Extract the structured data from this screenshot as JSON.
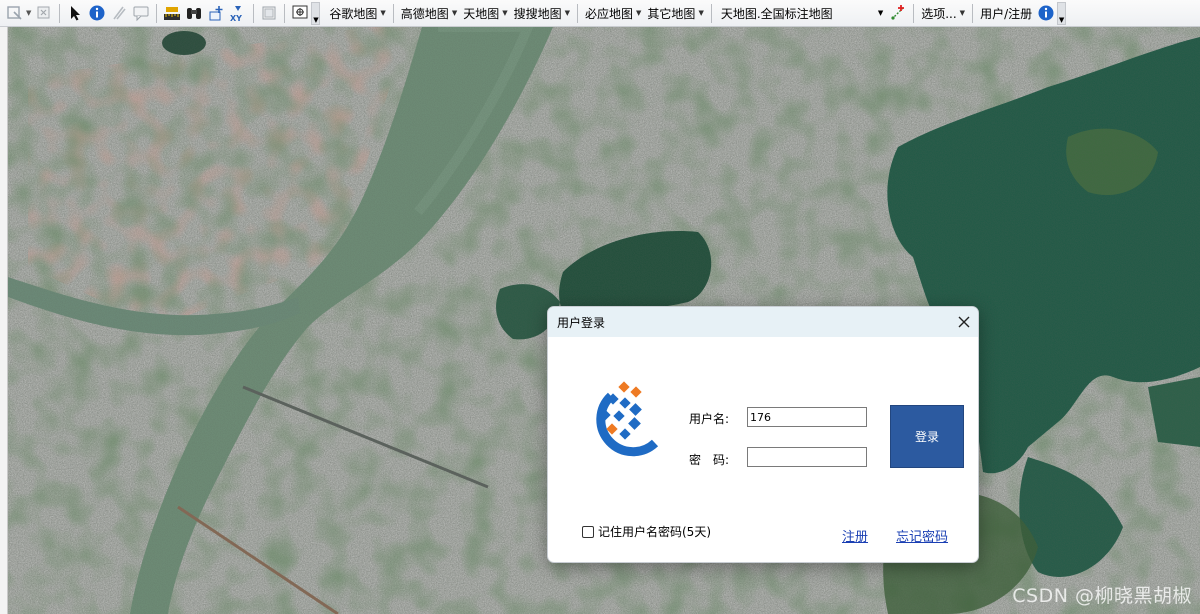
{
  "toolbar": {
    "icons": [
      "zoom-extent-icon",
      "clear-icon",
      "select-arrow-icon",
      "info-icon",
      "measure-icon",
      "comment-icon",
      "ruler-icon",
      "binoculars-icon",
      "coordinate-icon",
      "xy-icon",
      "layers-icon",
      "locate-icon"
    ],
    "menus": [
      {
        "key": "google",
        "label": "谷歌地图"
      },
      {
        "key": "gaode",
        "label": "高德地图"
      },
      {
        "key": "tianditu",
        "label": "天地图"
      },
      {
        "key": "sousou",
        "label": "搜搜地图"
      },
      {
        "key": "bing",
        "label": "必应地图"
      },
      {
        "key": "other",
        "label": "其它地图"
      }
    ],
    "layer_select_value": "天地图.全国标注地图",
    "options_label": "选项...",
    "user_label": "用户/注册"
  },
  "map": {
    "watermark": "CSDN @柳晓黑胡椒"
  },
  "dialog": {
    "title": "用户登录",
    "username_label": "用户名:",
    "username_value": "176",
    "password_label": "密　码:",
    "password_value": "",
    "login_button": "登录",
    "remember_label": "记住用户名密码(5天)",
    "register_link": "注册",
    "forgot_link": "忘记密码"
  },
  "colors": {
    "login_button": "#2c5aa0",
    "title_bar": "#e7f1f6",
    "link": "#1a3fb3",
    "logo_blue": "#1f6bc4",
    "logo_orange": "#ee7a23"
  }
}
